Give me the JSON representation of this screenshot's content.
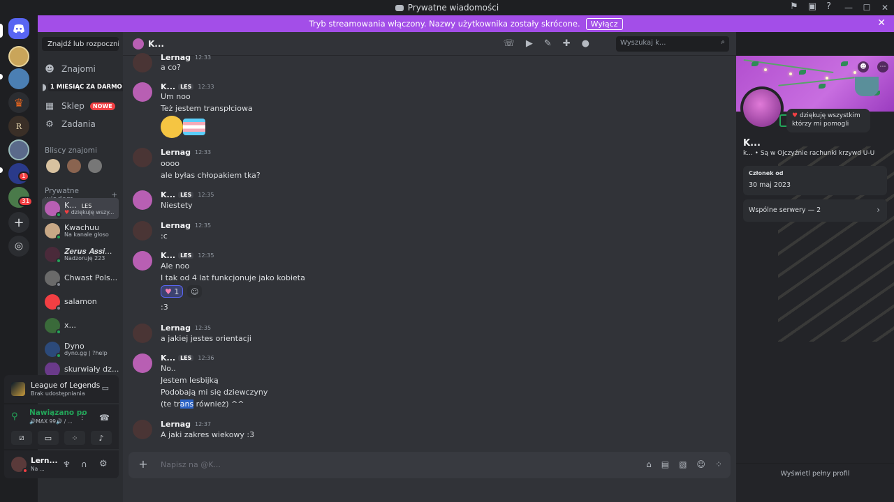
{
  "window": {
    "title": "Prywatne wiadomości"
  },
  "banner": {
    "text": "Tryb streamowania włączony. Nazwy użytkownika zostały skrócone.",
    "button": "Wyłącz"
  },
  "servers": [
    {
      "icon": "discord-home-icon",
      "badge": ""
    },
    {
      "icon": "server-icon",
      "badge": ""
    },
    {
      "icon": "server-icon",
      "badge": ""
    },
    {
      "icon": "server-icon",
      "badge": ""
    },
    {
      "icon": "server-icon",
      "badge": ""
    },
    {
      "icon": "server-icon",
      "badge": ""
    },
    {
      "icon": "server-icon",
      "badge": "1"
    },
    {
      "icon": "server-icon",
      "badge": "31"
    }
  ],
  "sidebar": {
    "find_button": "Znajdź lub rozpocznij...",
    "nav": {
      "friends": "Znajomi",
      "nitro_tag": "1 MIESIĄC ZA DARMO",
      "shop": "Sklep",
      "shop_badge": "NOWE",
      "tasks": "Zadania"
    },
    "recent_friends_header": "Bliscy znajomi",
    "dm_header": "Prywatne wiadom...",
    "dms": [
      {
        "name": "K...",
        "tag": "LES",
        "sub": "dziękuję wszy...",
        "status_color": "#23a559"
      },
      {
        "name": "Kwachuu",
        "tag": "",
        "sub": "Na kanale głoso",
        "status_color": "#23a559"
      },
      {
        "name": "𝒁𝒆𝒓𝒖𝒔 𝑨𝒔𝒔𝒊...",
        "tag": "",
        "sub": "Nadzoruję 223",
        "status_color": "#23a559"
      },
      {
        "name": "Chwast Pols...",
        "tag": "",
        "sub": "",
        "status_color": "#80848e"
      },
      {
        "name": "salamon",
        "tag": "",
        "sub": "",
        "status_color": "#80848e"
      },
      {
        "name": "x...",
        "tag": "",
        "sub": "",
        "status_color": "#23a559"
      },
      {
        "name": "Dyno",
        "tag": "",
        "sub": "dyno.gg | ?help",
        "status_color": "#23a559"
      },
      {
        "name": "skurwiały dz...",
        "tag": "",
        "sub": "",
        "status_color": "#23a559"
      }
    ]
  },
  "game_panel": {
    "title": "League of Legends",
    "sub": "Brak udostępniania"
  },
  "voice_panel": {
    "status": "Nawiązano po",
    "sub": "🔊MAX 99🔊 / ..."
  },
  "user_panel": {
    "name": "Lern...",
    "sub": "Na ..."
  },
  "chat": {
    "header_name": "K...",
    "search_placeholder": "Wyszukaj k...",
    "composer_placeholder": "Napisz na @K...",
    "messages": [
      {
        "author": "Lernag",
        "time": "12:33",
        "tag": "",
        "lines": [
          "a co?"
        ]
      },
      {
        "author": "K...",
        "time": "12:33",
        "tag": "LES",
        "lines": [
          "Um noo",
          "Też jestem transpłciowa"
        ]
      },
      {
        "author": "Lernag",
        "time": "12:33",
        "tag": "",
        "lines": [
          "oooo",
          "ale byłas chłopakiem tka?"
        ]
      },
      {
        "author": "K...",
        "time": "12:35",
        "tag": "LES",
        "lines": [
          "Niestety"
        ]
      },
      {
        "author": "Lernag",
        "time": "12:35",
        "tag": "",
        "lines": [
          ":c"
        ]
      },
      {
        "author": "K...",
        "time": "12:35",
        "tag": "LES",
        "lines": [
          "Ale noo",
          "I tak od 4 lat funkcjonuje jako kobieta",
          ":3"
        ]
      },
      {
        "author": "Lernag",
        "time": "12:35",
        "tag": "",
        "lines": [
          "a jakiej jestes orientacji"
        ]
      },
      {
        "author": "K...",
        "time": "12:36",
        "tag": "LES",
        "lines": [
          "No..",
          "Jestem lesbijką",
          "Podobają mi się dziewczyny"
        ]
      },
      {
        "author": "Lernag",
        "time": "12:37",
        "tag": "",
        "lines": [
          "A jaki zakres wiekowy :3"
        ]
      }
    ],
    "last_line": {
      "before": "(te tr",
      "highlight": "ans",
      "after": " również) ^^"
    },
    "reaction_count": "1"
  },
  "profile": {
    "status": "dziękuję wszystkim którzy mi pomogli",
    "name": "K...",
    "sub": "k...  •  Są w Ojczyźnie rachunki krzywd U-U",
    "member_since_label": "Członek od",
    "member_since": "30 maj 2023",
    "mutual_servers": "Wspólne serwery — 2",
    "view_full": "Wyświetl pełny profil"
  },
  "colors": {
    "accent": "#5865f2",
    "banner": "#a34ee8",
    "online": "#23a559",
    "danger": "#f23f43"
  }
}
